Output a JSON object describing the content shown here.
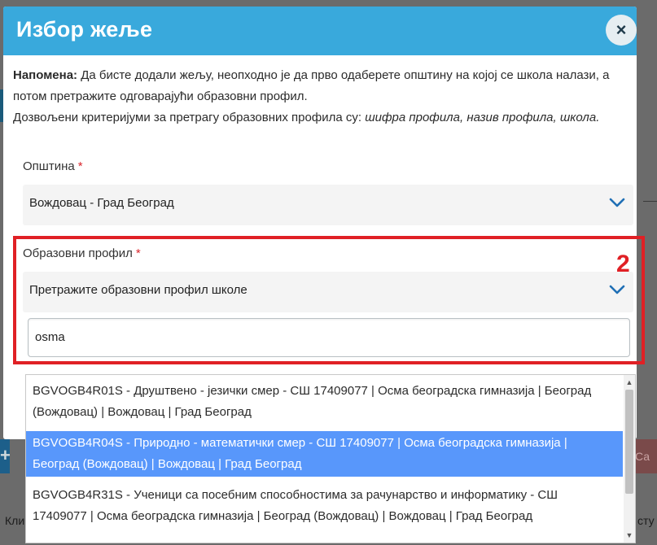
{
  "modal": {
    "title": "Избор жеље",
    "close_symbol": "×"
  },
  "note": {
    "bold_label": "Напомена:",
    "line1": " Да бисте додали жељу, неопходно је да прво одаберете општину на којој се школа налази, а потом претражите одговарајући образовни профил.",
    "line2_prefix": "Дозвољени критеријуми за претрагу образовних профила су: ",
    "line2_italic": "шифра профила, назив профила, школа."
  },
  "municipality": {
    "label": "Општина",
    "required_mark": "*",
    "value": "Вождовац - Град Београд"
  },
  "profile": {
    "label": "Образовни профил",
    "required_mark": "*",
    "placeholder": "Претражите образовни профил школе",
    "search_value": "osma"
  },
  "annotation_number": "2",
  "results": [
    {
      "line1": "BGVOGB4R01S - Друштвено - језички смер - СШ 17409077 | Осма београдска гимназија | Београд",
      "line2": "(Вождовац) | Вождовац | Град Београд",
      "selected": false
    },
    {
      "line1": "BGVOGB4R04S - Природно - математички смер - СШ 17409077 | Осма београдска гимназија |",
      "line2": "Београд (Вождовац) | Вождовац | Град Београд",
      "selected": true
    },
    {
      "line1": "BGVOGB4R31S - Ученици са посебним способностима за рачунарство и информатику - СШ",
      "line2": "17409077 | Осма београдска гимназија | Београд (Вождовац) | Вождовац | Град Београд",
      "selected": false
    }
  ],
  "background": {
    "left_text": "Кли",
    "right_text": "сту",
    "plus_symbol": "+",
    "right_button": "Са"
  },
  "colors": {
    "header": "#39a9dc",
    "selected_option": "#5897fb",
    "annotation": "#e02025"
  }
}
